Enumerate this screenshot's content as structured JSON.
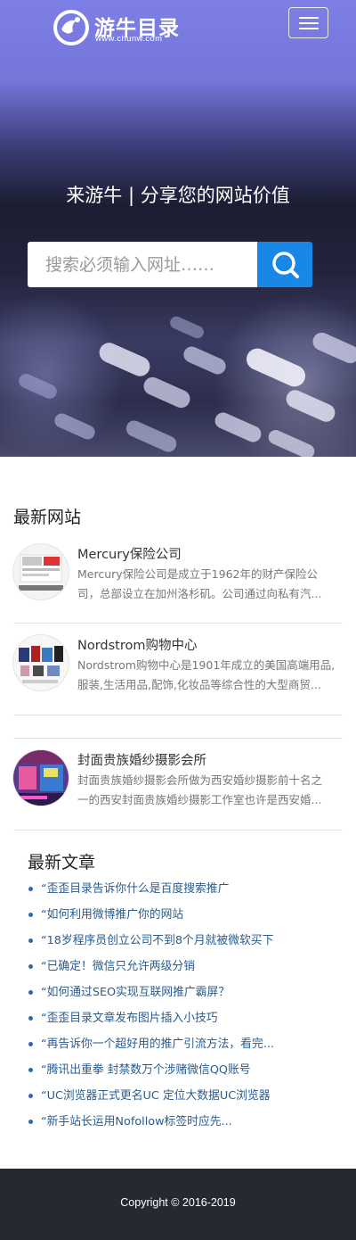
{
  "header": {
    "logo_name": "游牛目录",
    "logo_url": "www.chunw.com",
    "menu_icon": "hamburger-menu-icon"
  },
  "hero": {
    "slogan": "来游牛 | 分享您的网站价值",
    "search_placeholder": "搜索必须输入网址……",
    "search_icon": "search-icon"
  },
  "latest_sites": {
    "title": "最新网站",
    "items": [
      {
        "name": "Mercury保险公司",
        "desc_line1": "Mercury保险公司是成立于1962年的财产保险公",
        "desc_line2": "司，总部设立在加州洛杉矶。公司通过向私有汽..."
      },
      {
        "name": "Nordstrom购物中心",
        "desc_line1": "Nordstrom购物中心是1901年成立的美国高端用品,",
        "desc_line2": "服装,生活用品,配饰,化妆品等综合性的大型商贸..."
      },
      {
        "name": "封面贵族婚纱摄影会所",
        "desc_line1": "封面贵族婚纱摄影会所做为西安婚纱摄影前十名之",
        "desc_line2": "一的西安封面贵族婚纱摄影工作室也许是西安婚..."
      }
    ]
  },
  "latest_articles": {
    "title": "最新文章",
    "items": [
      "“歪歪目录告诉你什么是百度搜索推广",
      "“如何利用微博推广你的网站",
      "“18岁程序员创立公司不到8个月就被微软买下",
      "“已确定！微信只允许两级分销",
      "“如何通过SEO实现互联网推广霸屏？",
      "“歪歪目录文章发布图片插入小技巧",
      "“再告诉你一个超好用的推广引流方法，看完...",
      "“腾讯出重拳 封禁数万个涉赌微信QQ账号",
      "“UC浏览器正式更名UC 定位大数据UC浏览器",
      "“新手站长运用Nofollow标签时应先..."
    ]
  },
  "footer": {
    "copyright": "Copyright © 2016-2019"
  },
  "colors": {
    "accent": "#1987e6",
    "link": "#2a5b8c",
    "footer_bg": "#272932"
  }
}
